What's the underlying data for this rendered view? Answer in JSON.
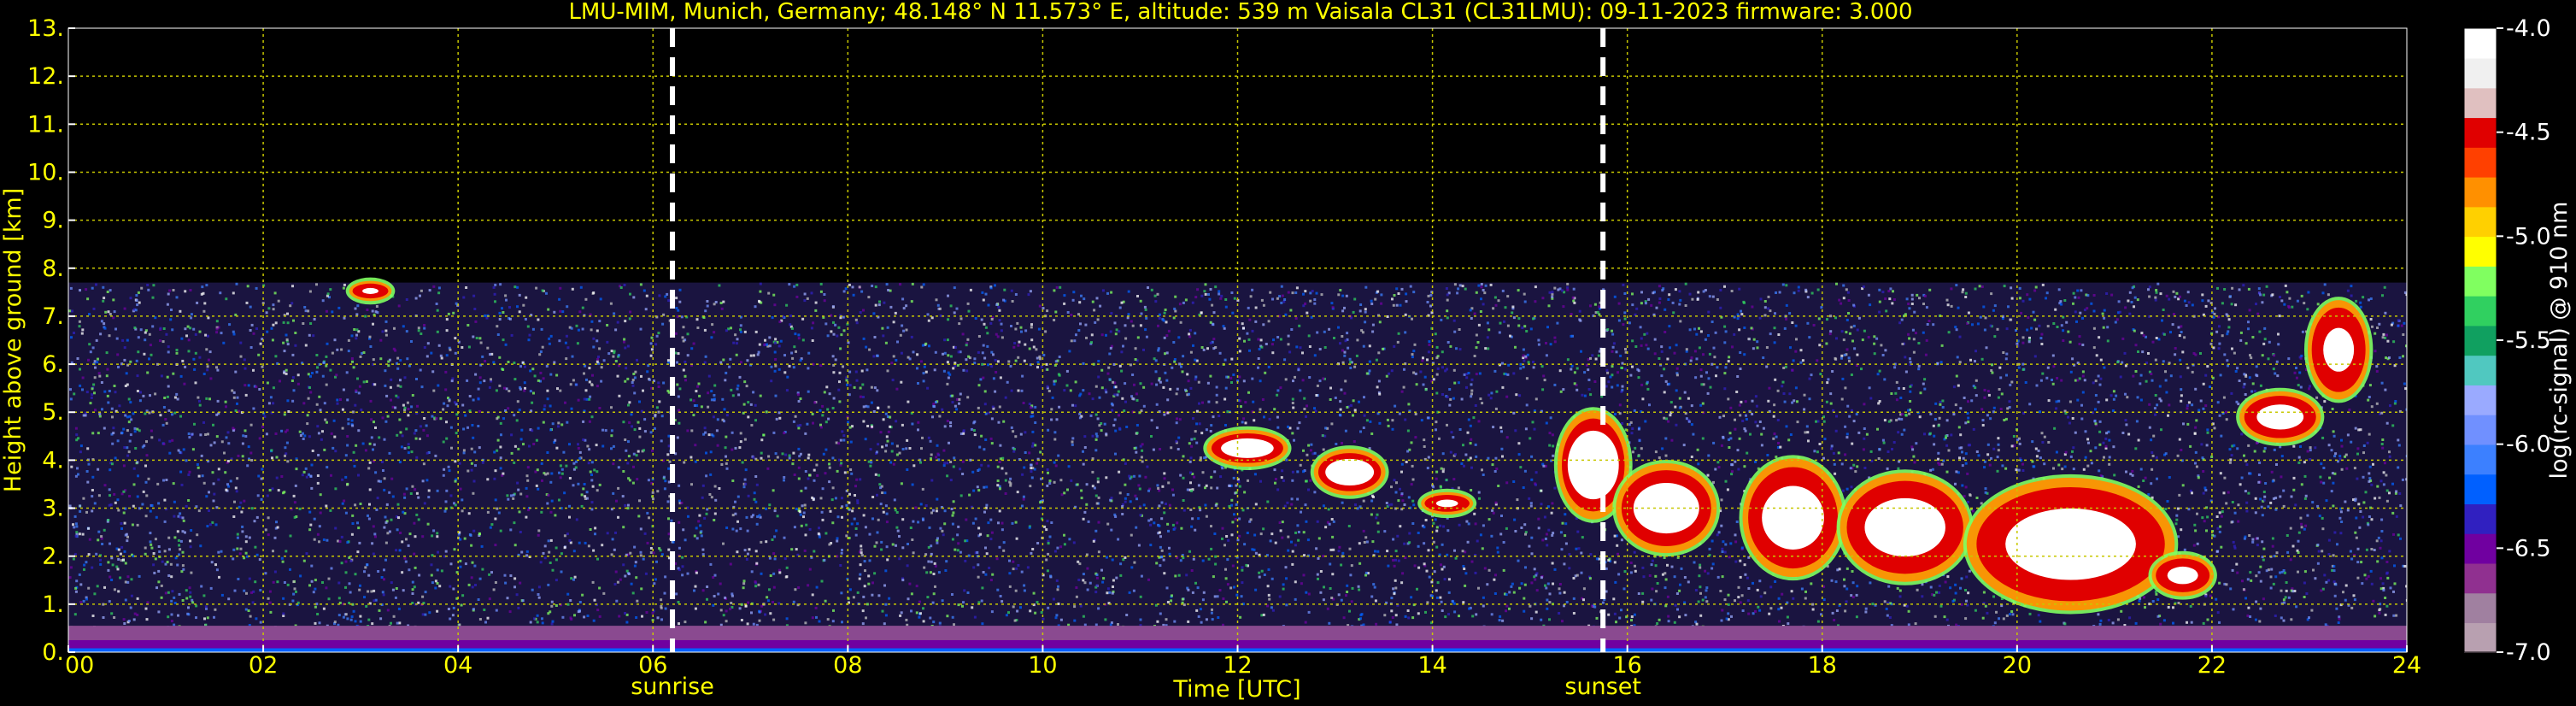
{
  "chart_data": {
    "type": "heatmap",
    "title": "LMU-MIM, Munich, Germany; 48.148° N 11.573° E, altitude: 539 m    Vaisala CL31 (CL31LMU): 09-11-2023    firmware: 3.000",
    "xlabel": "Time [UTC]",
    "ylabel": "Height above ground [km]",
    "colorbar_label": "log(rc-signal) @ 910 nm",
    "xlim": [
      0,
      24
    ],
    "ylim": [
      0,
      13
    ],
    "clim": [
      -7.0,
      -4.0
    ],
    "x_ticks": [
      0,
      2,
      4,
      6,
      8,
      10,
      12,
      14,
      16,
      18,
      20,
      22,
      24
    ],
    "x_tick_labels": [
      "00",
      "02",
      "04",
      "06",
      "08",
      "10",
      "12",
      "14",
      "16",
      "18",
      "20",
      "22",
      "24"
    ],
    "y_ticks": [
      0,
      1,
      2,
      3,
      4,
      5,
      6,
      7,
      8,
      9,
      10,
      11,
      12,
      13
    ],
    "y_tick_labels": [
      "0.",
      "1.",
      "2.",
      "3.",
      "4.",
      "5.",
      "6.",
      "7.",
      "8.",
      "9.",
      "10.",
      "11.",
      "12.",
      "13."
    ],
    "colorbar_ticks": [
      -7.0,
      -6.5,
      -6.0,
      -5.5,
      -5.0,
      -4.5,
      -4.0
    ],
    "colorbar_tick_labels": [
      "-7.0",
      "-6.5",
      "-6.0",
      "-5.5",
      "-5.0",
      "-4.5",
      "-4.0"
    ],
    "grid": true,
    "signal_top_km": 7.7,
    "markers": [
      {
        "label": "sunrise",
        "time": 6.2
      },
      {
        "label": "sunset",
        "time": 15.75
      }
    ],
    "cloud_layers": [
      {
        "t0": 2.9,
        "t1": 3.3,
        "base": 7.35,
        "top": 7.7,
        "intensity": 0.55
      },
      {
        "t0": 11.7,
        "t1": 12.5,
        "base": 3.9,
        "top": 4.6,
        "intensity": 0.9
      },
      {
        "t0": 12.8,
        "t1": 13.5,
        "base": 3.3,
        "top": 4.2,
        "intensity": 0.95
      },
      {
        "t0": 13.9,
        "t1": 14.4,
        "base": 2.9,
        "top": 3.3,
        "intensity": 0.6
      },
      {
        "t0": 15.3,
        "t1": 16.0,
        "base": 2.8,
        "top": 5.0,
        "intensity": 1.0
      },
      {
        "t0": 15.9,
        "t1": 16.9,
        "base": 2.1,
        "top": 3.9,
        "intensity": 0.9
      },
      {
        "t0": 17.2,
        "t1": 18.2,
        "base": 1.6,
        "top": 4.0,
        "intensity": 0.85
      },
      {
        "t0": 18.2,
        "t1": 19.5,
        "base": 1.5,
        "top": 3.7,
        "intensity": 0.85
      },
      {
        "t0": 19.5,
        "t1": 21.6,
        "base": 0.9,
        "top": 3.6,
        "intensity": 0.85
      },
      {
        "t0": 21.4,
        "t1": 22.0,
        "base": 1.2,
        "top": 2.0,
        "intensity": 0.7
      },
      {
        "t0": 22.3,
        "t1": 23.1,
        "base": 4.4,
        "top": 5.4,
        "intensity": 0.8
      },
      {
        "t0": 23.0,
        "t1": 23.6,
        "base": 5.3,
        "top": 7.3,
        "intensity": 0.7
      }
    ],
    "colors": {
      "background": "#000000",
      "text": "#ffff00",
      "grid": "#c8c800",
      "marker": "#ffffff",
      "boundary_layer": "#8a4a90",
      "colormap": [
        "#b8a0b0",
        "#a080a0",
        "#903090",
        "#7000a0",
        "#3020c0",
        "#0060ff",
        "#3c80ff",
        "#7090ff",
        "#9aaaff",
        "#50c8c0",
        "#10a060",
        "#30d060",
        "#80ff60",
        "#ffff00",
        "#ffd000",
        "#ff9000",
        "#ff4000",
        "#e00000",
        "#e0c0c0",
        "#f0f0f0",
        "#ffffff"
      ]
    }
  }
}
